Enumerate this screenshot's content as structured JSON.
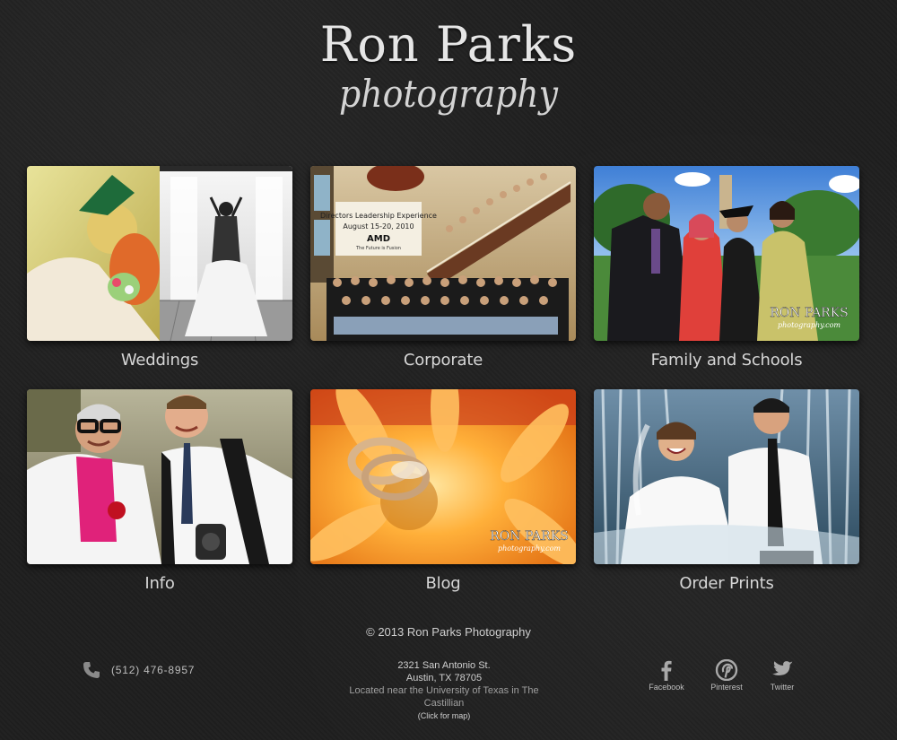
{
  "header": {
    "title": "Ron Parks",
    "subtitle": "photography"
  },
  "tiles": [
    {
      "label": "Weddings",
      "image": "wedding-bride-photos"
    },
    {
      "label": "Corporate",
      "image": "corporate-group-photo"
    },
    {
      "label": "Family and Schools",
      "image": "graduation-family-photo"
    },
    {
      "label": "Info",
      "image": "portrait-photographer-photo"
    },
    {
      "label": "Blog",
      "image": "wedding-rings-flower-photo"
    },
    {
      "label": "Order Prints",
      "image": "bride-groom-fountain-photo"
    }
  ],
  "overlay": {
    "corporate_banner_line1": "Directors Leadership Experience",
    "corporate_banner_line2": "August 15-20, 2010",
    "corporate_banner_brand": "AMD",
    "corporate_banner_tagline": "The Future is Fusion",
    "watermark_title": "RON PARKS",
    "watermark_sub": "photography.com"
  },
  "footer": {
    "copyright": "© 2013 Ron Parks Photography",
    "phone": "(512) 476-8957",
    "address_line1": "2321 San Antonio St.",
    "address_line2": "Austin, TX 78705",
    "address_near": "Located near the University of Texas in The Castillian",
    "map_link": "(Click for map)"
  },
  "social": [
    {
      "label": "Facebook",
      "icon": "facebook-icon"
    },
    {
      "label": "Pinterest",
      "icon": "pinterest-icon"
    },
    {
      "label": "Twitter",
      "icon": "twitter-icon"
    }
  ],
  "colors": {
    "background": "#1f1f1f",
    "text": "#d6d6d6",
    "muted": "#9f9f9f"
  }
}
